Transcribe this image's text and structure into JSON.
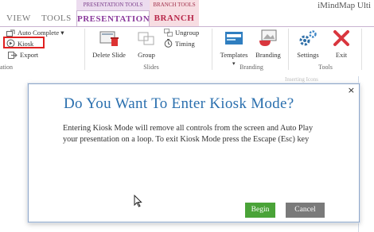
{
  "window": {
    "title": "iMindMap Ulti"
  },
  "context_groups": {
    "presentation_tools": "PRESENTATION TOOLS",
    "branch_tools": "BRANCH TOOLS"
  },
  "tabs": {
    "view": "VIEW",
    "tools": "TOOLS",
    "presentation": "PRESENTATION",
    "branch": "BRANCH"
  },
  "ribbon": {
    "auto_complete": "Auto Complete ▾",
    "kiosk": "Kiosk",
    "export": "Export",
    "left_group_label": "ation",
    "delete_slide": "Delete Slide",
    "group": "Group",
    "ungroup": "Ungroup",
    "timing": "Timing",
    "slides_label": "Slides",
    "templates": "Templates",
    "branding": "Branding",
    "branding_label": "Branding",
    "settings": "Settings",
    "exit": "Exit",
    "tools_label": "Tools"
  },
  "workspace": {
    "faded_label": "Inserting Icons"
  },
  "dialog": {
    "title": "Do You Want To Enter Kiosk Mode?",
    "body": "Entering Kiosk Mode will remove all controls from the screen and Auto Play your presentation on a loop. To exit Kiosk Mode press the Escape (Esc) key",
    "close": "×",
    "begin": "Begin",
    "cancel": "Cancel"
  },
  "colors": {
    "title_blue": "#2a6fae",
    "begin_green": "#4aa338",
    "cancel_gray": "#7a7a7a",
    "presentation_purple": "#8a3a9c",
    "branch_red": "#b8284a",
    "highlight_red": "#e02020"
  }
}
